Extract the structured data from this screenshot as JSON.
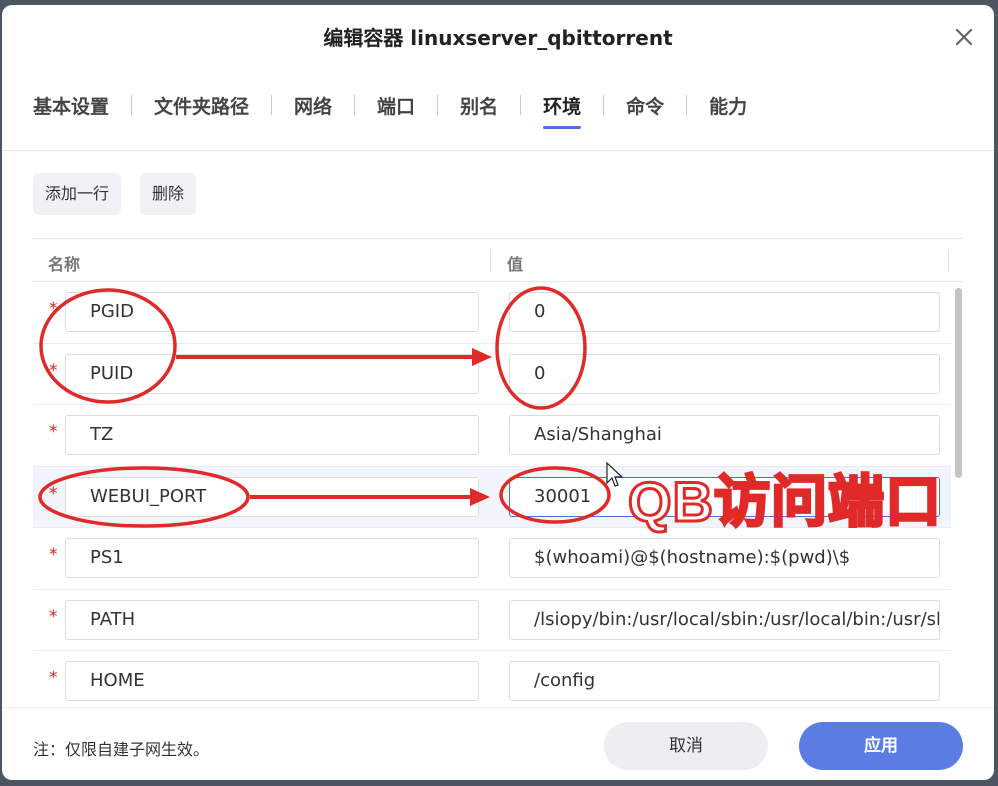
{
  "dialog": {
    "title": "编辑容器 linuxserver_qbittorrent"
  },
  "tabs": [
    {
      "label": "基本设置"
    },
    {
      "label": "文件夹路径"
    },
    {
      "label": "网络"
    },
    {
      "label": "端口"
    },
    {
      "label": "别名"
    },
    {
      "label": "环境",
      "active": true
    },
    {
      "label": "命令"
    },
    {
      "label": "能力"
    }
  ],
  "toolbar": {
    "add_row": "添加一行",
    "delete": "删除"
  },
  "table": {
    "headers": {
      "name": "名称",
      "value": "值"
    },
    "required_mark": "*",
    "rows": [
      {
        "name": "PGID",
        "value": "0"
      },
      {
        "name": "PUID",
        "value": "0"
      },
      {
        "name": "TZ",
        "value": "Asia/Shanghai"
      },
      {
        "name": "WEBUI_PORT",
        "value": "30001"
      },
      {
        "name": "PS1",
        "value": "$(whoami)@$(hostname):$(pwd)\\$"
      },
      {
        "name": "PATH",
        "value": "/lsiopy/bin:/usr/local/sbin:/usr/local/bin:/usr/sbin:/usr/bin:/sbin:/bin"
      },
      {
        "name": "HOME",
        "value": "/config"
      }
    ]
  },
  "footer": {
    "note": "注：仅限自建子网生效。",
    "cancel": "取消",
    "apply": "应用"
  },
  "annotation": {
    "text": "QB访问端口",
    "color": "#e02a2a"
  },
  "colors": {
    "accent": "#5b7de3",
    "tab_underline": "#4f6ee0",
    "required": "#d22222"
  }
}
